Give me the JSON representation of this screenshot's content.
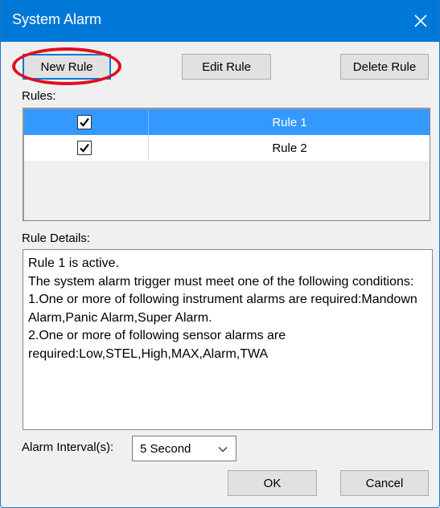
{
  "window": {
    "title": "System Alarm",
    "close_icon": "close-icon"
  },
  "toolbar": {
    "new_rule_label": "New Rule",
    "edit_rule_label": "Edit Rule",
    "delete_rule_label": "Delete Rule"
  },
  "annotation": {
    "highlight_color": "#e0101c",
    "highlight_target": "new-rule-button"
  },
  "rules": {
    "label": "Rules:",
    "items": [
      {
        "name": "Rule 1",
        "checked": true,
        "selected": true
      },
      {
        "name": "Rule 2",
        "checked": true,
        "selected": false
      }
    ]
  },
  "details": {
    "label": "Rule Details:",
    "text": "Rule 1 is active.\nThe system alarm trigger must meet one of the following conditions:\n1.One or more of following instrument alarms are required:Mandown Alarm,Panic Alarm,Super Alarm.\n2.One or more of following sensor alarms are required:Low,STEL,High,MAX,Alarm,TWA"
  },
  "interval": {
    "label": "Alarm Interval(s):",
    "selected": "5 Second"
  },
  "footer": {
    "ok_label": "OK",
    "cancel_label": "Cancel"
  },
  "colors": {
    "titlebar": "#0078d7",
    "selection": "#3399ff"
  }
}
